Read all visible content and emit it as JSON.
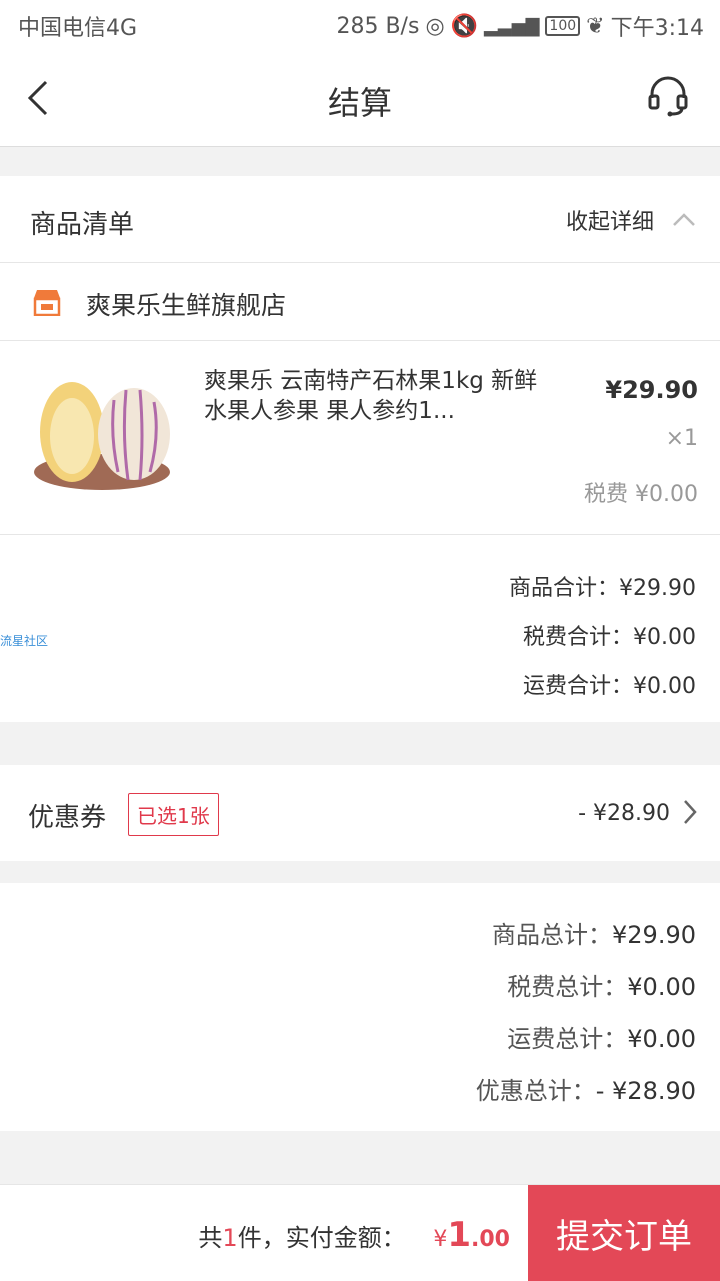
{
  "status": {
    "carrier": "中国电信4G",
    "speed": "285 B/s",
    "battery": "100",
    "time": "下午3:14"
  },
  "nav": {
    "title": "结算"
  },
  "goods": {
    "header": "商品清单",
    "collapse": "收起详细",
    "store": "爽果乐生鲜旗舰店",
    "product_title": "爽果乐 云南特产石林果1kg 新鲜水果人参果 果人参约1...",
    "price": "¥29.90",
    "qty": "×1",
    "tax": "税费 ¥0.00"
  },
  "subtotals": [
    {
      "label": "商品合计：",
      "value": "¥29.90"
    },
    {
      "label": "税费合计：",
      "value": "¥0.00"
    },
    {
      "label": "运费合计：",
      "value": "¥0.00"
    }
  ],
  "watermark": "流星社区",
  "coupon": {
    "label": "优惠券",
    "tag": "已选1张",
    "amount": "- ¥28.90"
  },
  "totals": [
    {
      "label": "商品总计：",
      "value": "¥29.90"
    },
    {
      "label": "税费总计：",
      "value": "¥0.00"
    },
    {
      "label": "运费总计：",
      "value": "¥0.00"
    },
    {
      "label": "优惠总计：",
      "value": "- ¥28.90"
    }
  ],
  "footer": {
    "count_prefix": "共",
    "count": "1",
    "count_suffix": "件，实付金额：",
    "pay_symbol": "¥",
    "pay_int": "1",
    "pay_dec": ".00",
    "submit": "提交订单"
  },
  "colors": {
    "accent": "#e34857",
    "store_icon": "#f07a3a"
  }
}
